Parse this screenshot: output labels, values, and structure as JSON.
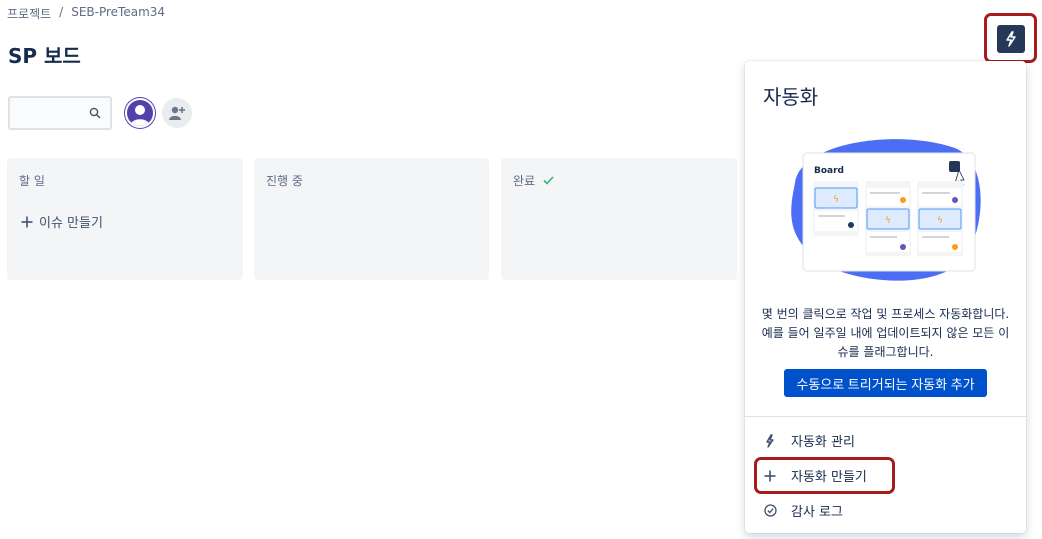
{
  "breadcrumb": {
    "project": "프로젝트",
    "separator": "/",
    "current": "SEB-PreTeam34"
  },
  "page": {
    "title": "SP 보드"
  },
  "search": {
    "placeholder": ""
  },
  "columns": [
    {
      "title": "할 일",
      "create_label": "이슈 만들기"
    },
    {
      "title": "진행 중"
    },
    {
      "title": "완료"
    }
  ],
  "automation_panel": {
    "title": "자동화",
    "illustration_board_label": "Board",
    "description_lines": [
      "몇 번의 클릭으로 작업 및 프로세스 자동화합니다.",
      "예를 들어 일주일 내에 업데이트되지 않은 모든 이",
      "슈를 플래그합니다."
    ],
    "add_button": "수동으로 트리거되는 자동화 추가",
    "menu": [
      {
        "label": "자동화 관리",
        "icon": "lightning-icon"
      },
      {
        "label": "자동화 만들기",
        "icon": "plus-icon"
      },
      {
        "label": "감사 로그",
        "icon": "check-circle-icon"
      }
    ]
  },
  "colors": {
    "accent": "#0052cc",
    "highlight": "#a61b1b",
    "column_bg": "#f4f5f7",
    "automation_btn": "#253858"
  }
}
